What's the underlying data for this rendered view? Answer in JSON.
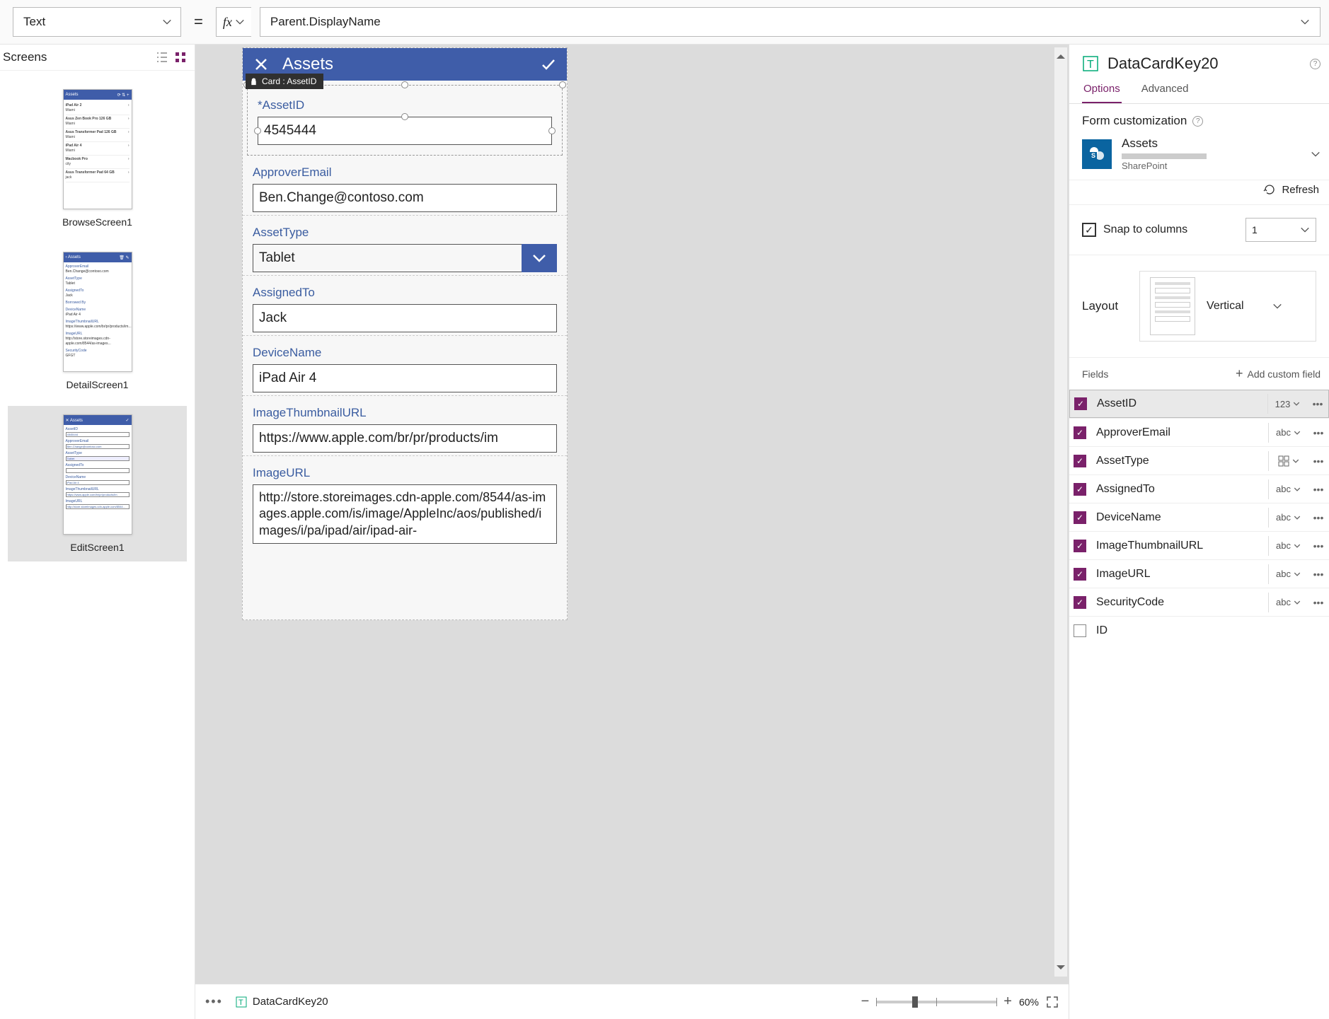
{
  "formula_bar": {
    "property": "Text",
    "formula": "Parent.DisplayName"
  },
  "left_panel": {
    "title": "Screens",
    "screens": [
      {
        "name": "BrowseScreen1"
      },
      {
        "name": "DetailScreen1"
      },
      {
        "name": "EditScreen1"
      }
    ]
  },
  "canvas": {
    "header_title": "Assets",
    "tooltip": "Card : AssetID",
    "cards": {
      "assetid": {
        "label": "AssetID",
        "required": true,
        "value": "4545444"
      },
      "approveremail": {
        "label": "ApproverEmail",
        "value": "Ben.Change@contoso.com"
      },
      "assettype": {
        "label": "AssetType",
        "value": "Tablet"
      },
      "assignedto": {
        "label": "AssignedTo",
        "value": "Jack"
      },
      "devicename": {
        "label": "DeviceName",
        "value": "iPad Air 4"
      },
      "imagethumbnailurl": {
        "label": "ImageThumbnailURL",
        "value": "https://www.apple.com/br/pr/products/im"
      },
      "imageurl": {
        "label": "ImageURL",
        "value": "http://store.storeimages.cdn-apple.com/8544/as-images.apple.com/is/image/AppleInc/aos/published/images/i/pa/ipad/air/ipad-air-"
      }
    }
  },
  "right_panel": {
    "title": "DataCardKey20",
    "tabs": {
      "options": "Options",
      "advanced": "Advanced"
    },
    "form_customization": "Form customization",
    "datasource": {
      "name": "Assets",
      "type": "SharePoint"
    },
    "refresh": "Refresh",
    "snap_label": "Snap to columns",
    "snap_value": "1",
    "layout_label": "Layout",
    "layout_value": "Vertical",
    "fields_label": "Fields",
    "add_custom": "Add custom field",
    "fields": [
      {
        "name": "AssetID",
        "type": "123",
        "checked": true,
        "selected": true
      },
      {
        "name": "ApproverEmail",
        "type": "abc",
        "checked": true
      },
      {
        "name": "AssetType",
        "type": "grid",
        "checked": true
      },
      {
        "name": "AssignedTo",
        "type": "abc",
        "checked": true
      },
      {
        "name": "DeviceName",
        "type": "abc",
        "checked": true
      },
      {
        "name": "ImageThumbnailURL",
        "type": "abc",
        "checked": true
      },
      {
        "name": "ImageURL",
        "type": "abc",
        "checked": true
      },
      {
        "name": "SecurityCode",
        "type": "abc",
        "checked": true
      },
      {
        "name": "ID",
        "type": "",
        "checked": false
      }
    ]
  },
  "status_bar": {
    "breadcrumb": "DataCardKey20",
    "zoom": "60%"
  }
}
